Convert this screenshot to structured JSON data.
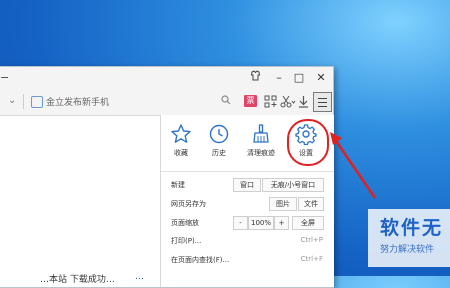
{
  "address_bar": {
    "text": "金立发布新手机"
  },
  "window_controls": {
    "minimize": "–",
    "maximize": "□",
    "close": "✕"
  },
  "toolbar": {
    "ticket_glyph": "票"
  },
  "quick_items": [
    {
      "label": "收藏",
      "icon": "star-icon"
    },
    {
      "label": "历史",
      "icon": "clock-icon"
    },
    {
      "label": "清理痕迹",
      "icon": "broom-icon"
    },
    {
      "label": "设置",
      "icon": "gear-icon"
    }
  ],
  "menu": {
    "new": {
      "label": "新建",
      "window": "窗口",
      "incognito": "无痕/小号窗口"
    },
    "save_as": {
      "label": "网页另存为",
      "image": "图片",
      "file": "文件"
    },
    "zoom": {
      "label": "页面缩放",
      "minus": "-",
      "value": "100%",
      "plus": "+",
      "fullscreen": "全屏"
    },
    "print": {
      "label": "打印(P)...",
      "shortcut": "Ctrl+P"
    },
    "find": {
      "label": "在页面内查找(F)...",
      "shortcut": "Ctrl+F"
    }
  },
  "page": {
    "text": "…本站   下载成功…",
    "blue_text": "…"
  },
  "watermark": {
    "title": "软件无",
    "subtitle": "努力解决软件"
  },
  "colors": {
    "highlight": "#e12020",
    "arrow": "#e12020",
    "accent": "#2f73c9",
    "watermark": "#1f62c6"
  }
}
